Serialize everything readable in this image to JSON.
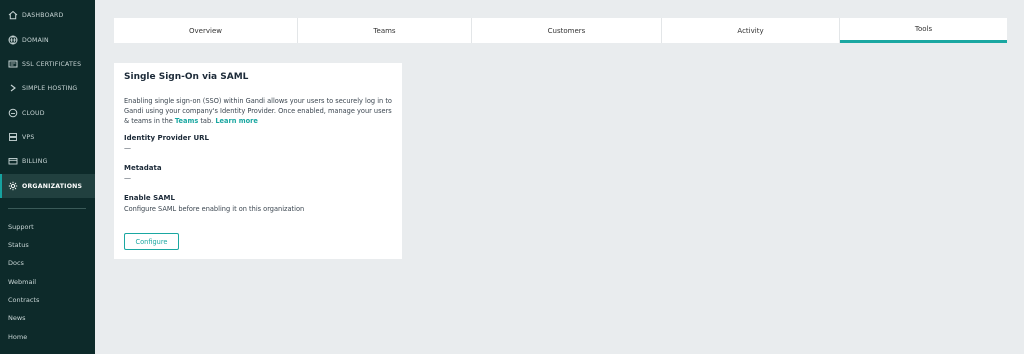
{
  "sidebar": {
    "items": [
      {
        "label": "DASHBOARD",
        "icon": "home-icon",
        "active": false
      },
      {
        "label": "DOMAIN",
        "icon": "globe-icon",
        "active": false
      },
      {
        "label": "SSL CERTIFICATES",
        "icon": "certificate-icon",
        "active": false
      },
      {
        "label": "SIMPLE HOSTING",
        "icon": "chevron-right-icon",
        "active": false
      },
      {
        "label": "CLOUD",
        "icon": "cloud-icon",
        "active": false
      },
      {
        "label": "VPS",
        "icon": "server-icon",
        "active": false
      },
      {
        "label": "BILLING",
        "icon": "card-icon",
        "active": false
      },
      {
        "label": "ORGANIZATIONS",
        "icon": "gear-icon",
        "active": true
      }
    ],
    "links": [
      "Support",
      "Status",
      "Docs",
      "Webmail",
      "Contracts",
      "News",
      "Home"
    ]
  },
  "tabs": [
    {
      "label": "Overview",
      "active": false
    },
    {
      "label": "Teams",
      "active": false
    },
    {
      "label": "Customers",
      "active": false
    },
    {
      "label": "Activity",
      "active": false
    },
    {
      "label": "Tools",
      "active": true
    }
  ],
  "saml": {
    "title": "Single Sign-On via SAML",
    "description_part1": "Enabling single sign-on (SSO) within Gandi allows your users to securely log in to Gandi using your company's Identity Provider. Once enabled, manage your users & teams in the ",
    "teams_link": "Teams",
    "description_part2": " tab. ",
    "learn_more": "Learn more",
    "idp_url_label": "Identity Provider URL",
    "idp_url_value": "—",
    "metadata_label": "Metadata",
    "metadata_value": "—",
    "enable_label": "Enable SAML",
    "enable_note": "Configure SAML before enabling it on this organization",
    "configure_button": "Configure"
  },
  "colors": {
    "sidebar_bg": "#0d2a2a",
    "accent": "#1aa7a1",
    "page_bg": "#e9ecee"
  }
}
